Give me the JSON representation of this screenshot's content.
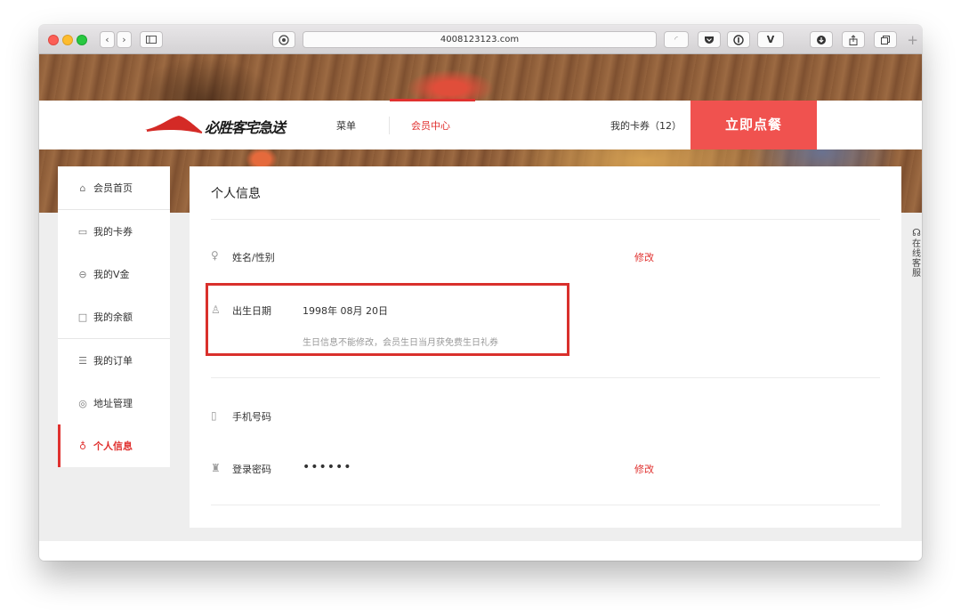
{
  "browser": {
    "url": "4008123123.com"
  },
  "header": {
    "logo_text": "必胜客宅急送",
    "nav": [
      {
        "label": "菜单"
      },
      {
        "label": "会员中心"
      }
    ],
    "coupons_label": "我的卡券（12）",
    "order_button": "立即点餐"
  },
  "sidebar": {
    "items": [
      {
        "label": "会员首页",
        "icon": "home-icon"
      },
      {
        "label": "我的卡券",
        "icon": "wallet-icon"
      },
      {
        "label": "我的V金",
        "icon": "v-coin-icon"
      },
      {
        "label": "我的余额",
        "icon": "balance-icon"
      },
      {
        "label": "我的订单",
        "icon": "order-list-icon"
      },
      {
        "label": "地址管理",
        "icon": "location-pin-icon"
      },
      {
        "label": "个人信息",
        "icon": "person-icon",
        "active": true
      }
    ]
  },
  "profile": {
    "title": "个人信息",
    "name_gender": {
      "label": "姓名/性别",
      "edit": "修改",
      "icon": "person-icon"
    },
    "birthday": {
      "label": "出生日期",
      "value": "1998年 08月 20日",
      "hint": "生日信息不能修改，会员生日当月获免费生日礼券",
      "icon": "cake-icon"
    },
    "phone": {
      "label": "手机号码",
      "icon": "phone-icon"
    },
    "password": {
      "label": "登录密码",
      "value": "••••••",
      "edit": "修改",
      "icon": "lock-icon"
    }
  },
  "service": {
    "label": "在线客服"
  },
  "colors": {
    "accent": "#e0312f",
    "order_button_bg": "#f0524f",
    "highlight_border": "#d9302c"
  }
}
